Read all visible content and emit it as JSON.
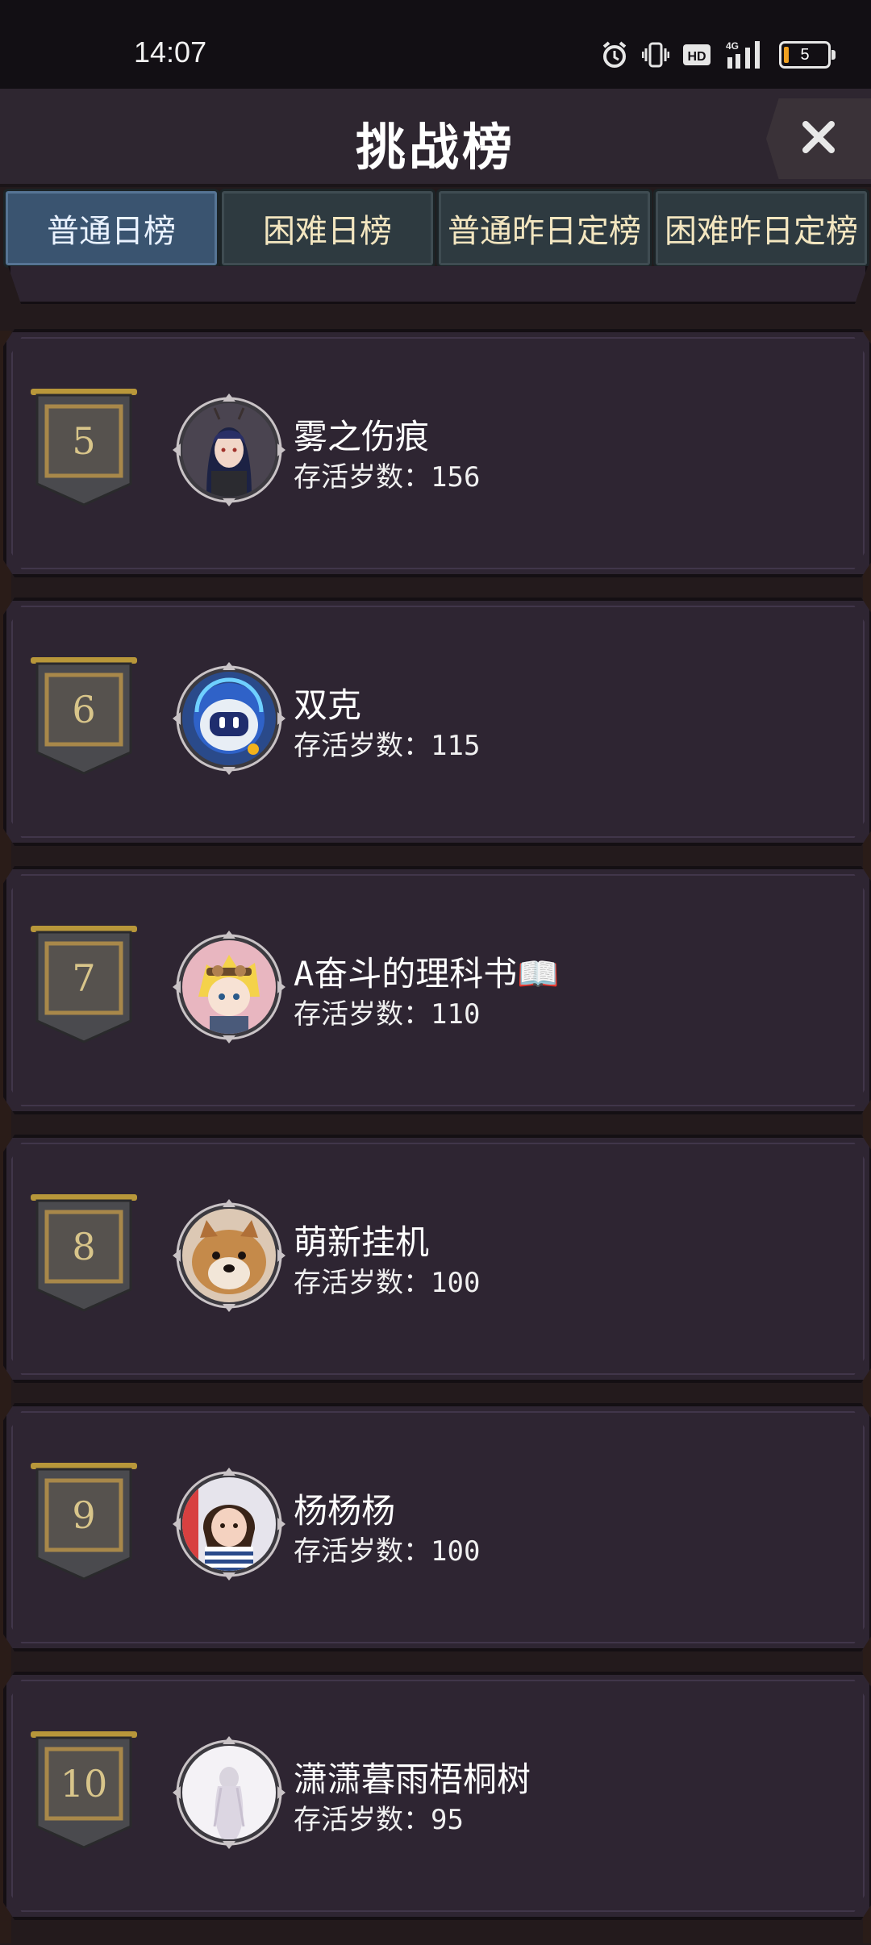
{
  "status_bar": {
    "time": "14:07",
    "battery": "5",
    "network": "4G",
    "hd": "HD"
  },
  "header": {
    "title": "挑战榜"
  },
  "tabs": [
    {
      "label": "普通日榜",
      "active": true
    },
    {
      "label": "困难日榜",
      "active": false
    },
    {
      "label": "普通昨日定榜",
      "active": false
    },
    {
      "label": "困难昨日定榜",
      "active": false
    }
  ],
  "score_label": "存活岁数：",
  "entries": [
    {
      "rank": "5",
      "name": "雾之伤痕",
      "score": "156",
      "avatar": "anime-girl-avatar"
    },
    {
      "rank": "6",
      "name": "双克",
      "score": "115",
      "avatar": "robot-avatar"
    },
    {
      "rank": "7",
      "name": "A奋斗的理科书📖",
      "score": "110",
      "avatar": "blonde-character-avatar"
    },
    {
      "rank": "8",
      "name": "萌新挂机",
      "score": "100",
      "avatar": "dog-avatar"
    },
    {
      "rank": "9",
      "name": "杨杨杨",
      "score": "100",
      "avatar": "child-photo-avatar"
    },
    {
      "rank": "10",
      "name": "潇潇暮雨梧桐树",
      "score": "95",
      "avatar": "ghost-figure-avatar"
    }
  ],
  "colors": {
    "tab_active": "#3a5470",
    "card_bg": "#2e2532",
    "rank_text": "#d8c58a"
  }
}
